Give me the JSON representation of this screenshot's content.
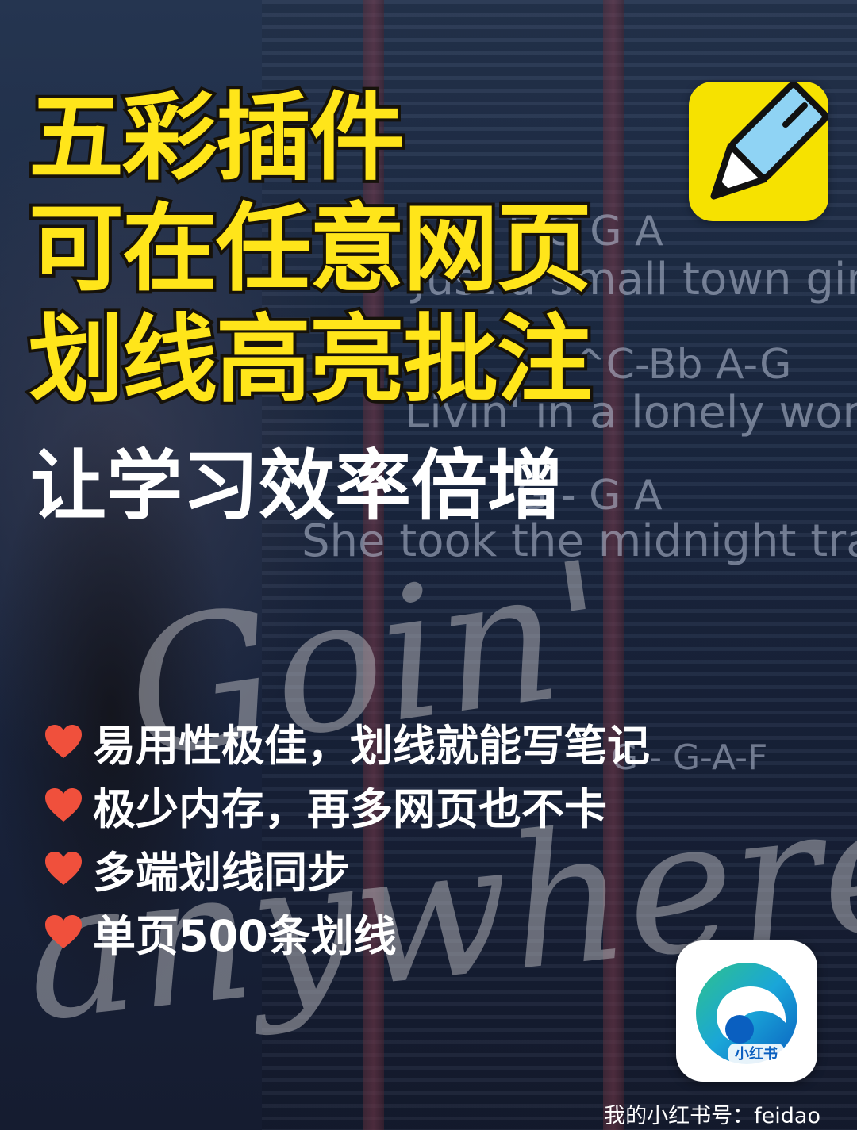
{
  "headline": {
    "line1": "五彩插件",
    "line2": "可在任意网页",
    "line3": "划线高亮批注"
  },
  "subtitle": "让学习效率倍增",
  "background_lyrics": {
    "chord1": "F   G    G    A",
    "line1": "Just a small town girl",
    "chord2": "^C-Bb  A-G",
    "line2": "Livin' in a lonely world",
    "chord3": "G - G    A",
    "line3": "She took the midnight train",
    "chord4": "G - G-A-F",
    "script1": "Goin'",
    "script2": "anywhere."
  },
  "features": [
    {
      "icon": "heart-icon",
      "text": "易用性极佳，划线就能写笔记"
    },
    {
      "icon": "heart-icon",
      "text": "极少内存，再多网页也不卡"
    },
    {
      "icon": "heart-icon",
      "text": "多端划线同步"
    },
    {
      "icon": "heart-icon",
      "text": "单页500条划线"
    }
  ],
  "edge_icon_label": "小红书",
  "watermark": "我的小红书号：feidao",
  "colors": {
    "headline": "#ffe51a",
    "subtitle": "#ffffff",
    "heart": "#f0503c",
    "app_icon_bg": "#f6e200"
  }
}
